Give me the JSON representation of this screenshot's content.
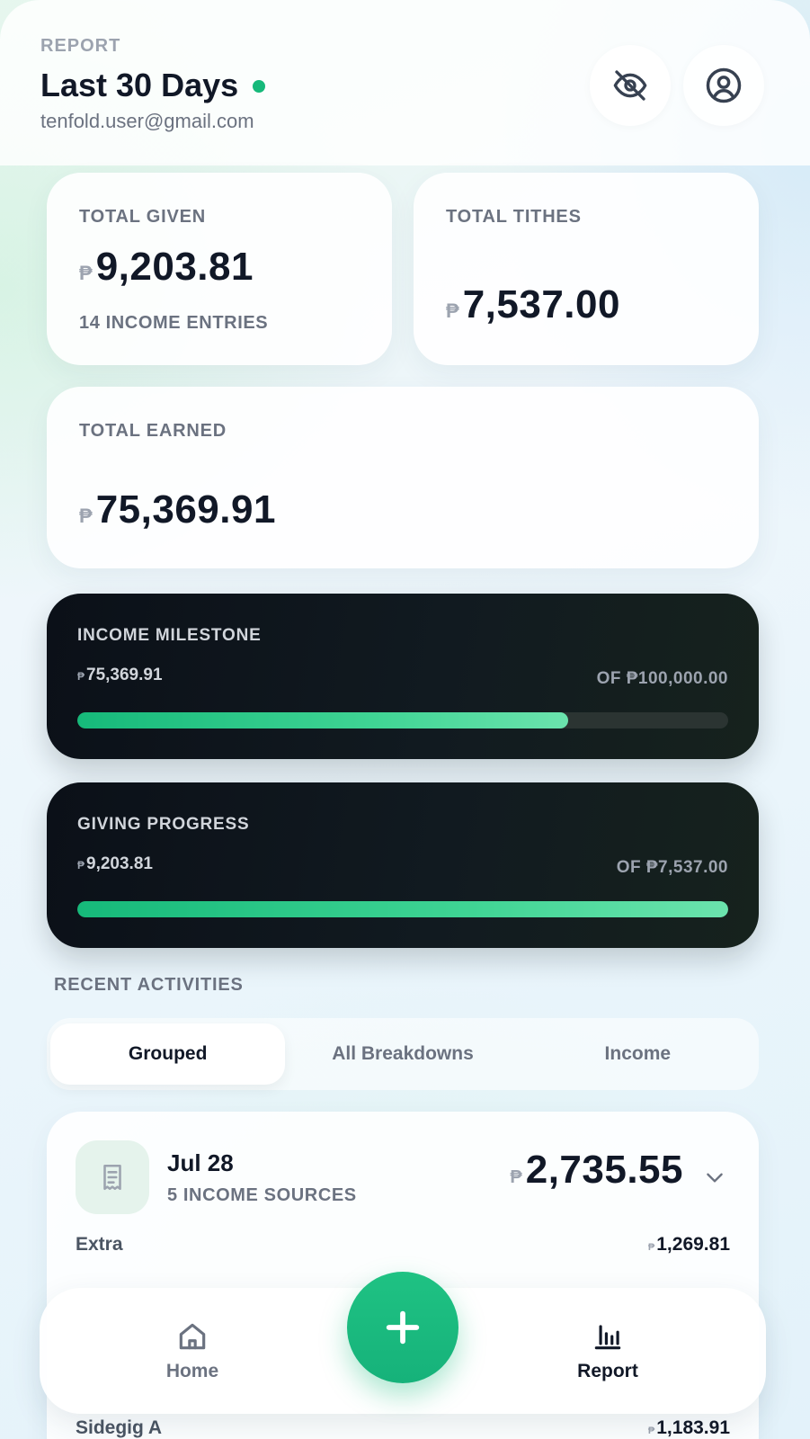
{
  "header": {
    "eyebrow": "REPORT",
    "title": "Last 30 Days",
    "email": "tenfold.user@gmail.com",
    "status_color": "#16b97a",
    "icons": [
      "eye-off-icon",
      "user-circle-icon"
    ]
  },
  "currency_symbol": "₱",
  "stats": {
    "total_given": {
      "label": "TOTAL GIVEN",
      "value": "9,203.81",
      "sub": "14 INCOME ENTRIES"
    },
    "total_tithes": {
      "label": "TOTAL TITHES",
      "value": "7,537.00"
    },
    "total_earned": {
      "label": "TOTAL EARNED",
      "value": "75,369.91"
    }
  },
  "milestones": {
    "income": {
      "label": "INCOME MILESTONE",
      "current": "75,369.91",
      "target": "OF ₱100,000.00",
      "progress_fraction": 0.7537
    },
    "giving": {
      "label": "GIVING PROGRESS",
      "current": "9,203.81",
      "target": "OF ₱7,537.00",
      "progress_fraction": 1.0
    }
  },
  "recent": {
    "title": "RECENT ACTIVITIES",
    "tabs": [
      {
        "label": "Grouped",
        "active": true
      },
      {
        "label": "All Breakdowns",
        "active": false
      },
      {
        "label": "Income",
        "active": false
      }
    ],
    "group": {
      "date": "Jul 28",
      "sub": "5 INCOME SOURCES",
      "total": "2,735.55",
      "items": [
        {
          "name": "Extra",
          "amount": "1,269.81"
        },
        {
          "name": "Sidegig A",
          "amount": "1,183.91"
        }
      ]
    }
  },
  "nav": {
    "home_label": "Home",
    "report_label": "Report",
    "accent": "#16b97a"
  }
}
